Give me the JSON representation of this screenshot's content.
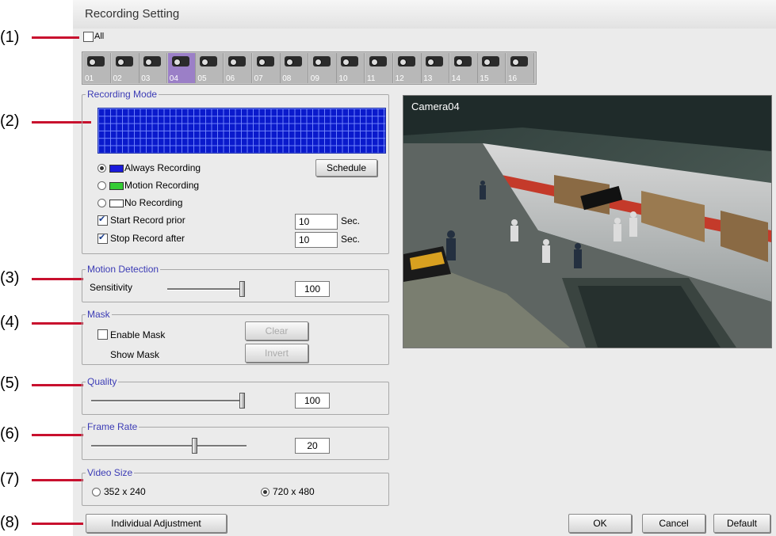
{
  "window": {
    "title": "Recording Setting"
  },
  "callouts": [
    "(1)",
    "(2)",
    "(3)",
    "(4)",
    "(5)",
    "(6)",
    "(7)",
    "(8)"
  ],
  "all_label": "All",
  "cameras": [
    "01",
    "02",
    "03",
    "04",
    "05",
    "06",
    "07",
    "08",
    "09",
    "10",
    "11",
    "12",
    "13",
    "14",
    "15",
    "16"
  ],
  "selected_camera": "04",
  "recording_mode": {
    "title": "Recording Mode",
    "schedule_button": "Schedule",
    "options": [
      "Always Recording",
      "Motion Recording",
      "No Recording"
    ],
    "selected": "Always Recording",
    "colors": {
      "always": "#1a1adc",
      "motion": "#33cc33",
      "none": "#ffffff"
    },
    "start_prior_label": "Start Record prior",
    "start_prior_value": "10",
    "stop_after_label": "Stop Record after",
    "stop_after_value": "10",
    "sec_label": "Sec."
  },
  "motion_detection": {
    "title": "Motion Detection",
    "sensitivity_label": "Sensitivity",
    "value": "100"
  },
  "mask": {
    "title": "Mask",
    "enable_label": "Enable Mask",
    "show_label": "Show Mask",
    "clear_button": "Clear",
    "invert_button": "Invert"
  },
  "quality": {
    "title": "Quality",
    "value": "100"
  },
  "frame_rate": {
    "title": "Frame Rate",
    "value": "20"
  },
  "video_size": {
    "title": "Video Size",
    "options": [
      "352 x 240",
      "720 x 480"
    ],
    "selected": "720 x 480"
  },
  "footer": {
    "individual_button": "Individual Adjustment",
    "ok_button": "OK",
    "cancel_button": "Cancel",
    "default_button": "Default"
  },
  "preview": {
    "camera_label": "Camera04"
  }
}
